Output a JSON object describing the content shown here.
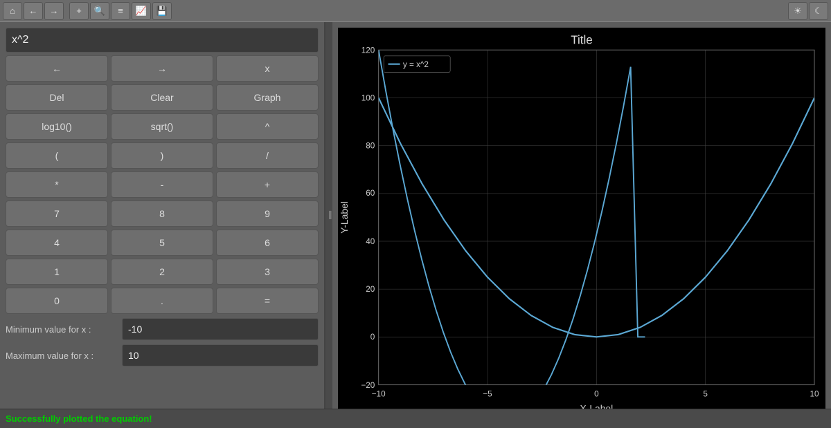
{
  "toolbar": {
    "buttons": [
      {
        "name": "home-icon",
        "symbol": "⌂"
      },
      {
        "name": "back-icon",
        "symbol": "←"
      },
      {
        "name": "forward-icon",
        "symbol": "→"
      },
      {
        "name": "add-icon",
        "symbol": "+"
      },
      {
        "name": "search-icon",
        "symbol": "🔍"
      },
      {
        "name": "settings-icon",
        "symbol": "≡"
      },
      {
        "name": "chart-icon",
        "symbol": "📈"
      },
      {
        "name": "save-icon",
        "symbol": "💾"
      }
    ],
    "right_buttons": [
      {
        "name": "brightness-icon",
        "symbol": "☀"
      },
      {
        "name": "moon-icon",
        "symbol": "☾"
      }
    ]
  },
  "calculator": {
    "expression": "x^2",
    "buttons": [
      {
        "label": "←",
        "name": "left-arrow-btn"
      },
      {
        "label": "→",
        "name": "right-arrow-btn"
      },
      {
        "label": "x",
        "name": "variable-x-btn"
      },
      {
        "label": "Del",
        "name": "delete-btn"
      },
      {
        "label": "Clear",
        "name": "clear-btn"
      },
      {
        "label": "Graph",
        "name": "graph-btn"
      },
      {
        "label": "log10()",
        "name": "log10-btn"
      },
      {
        "label": "sqrt()",
        "name": "sqrt-btn"
      },
      {
        "label": "^",
        "name": "power-btn"
      },
      {
        "label": "(",
        "name": "open-paren-btn"
      },
      {
        "label": ")",
        "name": "close-paren-btn"
      },
      {
        "label": "/",
        "name": "divide-btn"
      },
      {
        "label": "*",
        "name": "multiply-btn"
      },
      {
        "label": "-",
        "name": "subtract-btn"
      },
      {
        "label": "+",
        "name": "add-btn"
      },
      {
        "label": "7",
        "name": "seven-btn"
      },
      {
        "label": "8",
        "name": "eight-btn"
      },
      {
        "label": "9",
        "name": "nine-btn"
      },
      {
        "label": "4",
        "name": "four-btn"
      },
      {
        "label": "5",
        "name": "five-btn"
      },
      {
        "label": "6",
        "name": "six-btn"
      },
      {
        "label": "1",
        "name": "one-btn"
      },
      {
        "label": "2",
        "name": "two-btn"
      },
      {
        "label": "3",
        "name": "three-btn"
      },
      {
        "label": "0",
        "name": "zero-btn"
      },
      {
        "label": ".",
        "name": "decimal-btn"
      },
      {
        "label": "=",
        "name": "equals-btn"
      }
    ],
    "min_label": "Minimum value for x :",
    "max_label": "Maximum value for x :",
    "min_value": "-10",
    "max_value": "10"
  },
  "graph": {
    "title": "Title",
    "x_label": "X-Label",
    "y_label": "Y-Label",
    "legend": "y = x^2",
    "x_min": -10,
    "x_max": 10,
    "y_min": -20,
    "y_max": 120,
    "x_ticks": [
      -10,
      -5,
      0,
      5,
      10
    ],
    "y_ticks": [
      -20,
      0,
      20,
      40,
      60,
      80,
      100,
      120
    ],
    "curve_color": "#5ba8d4"
  },
  "status": {
    "message": "Successfully plotted the equation!"
  }
}
